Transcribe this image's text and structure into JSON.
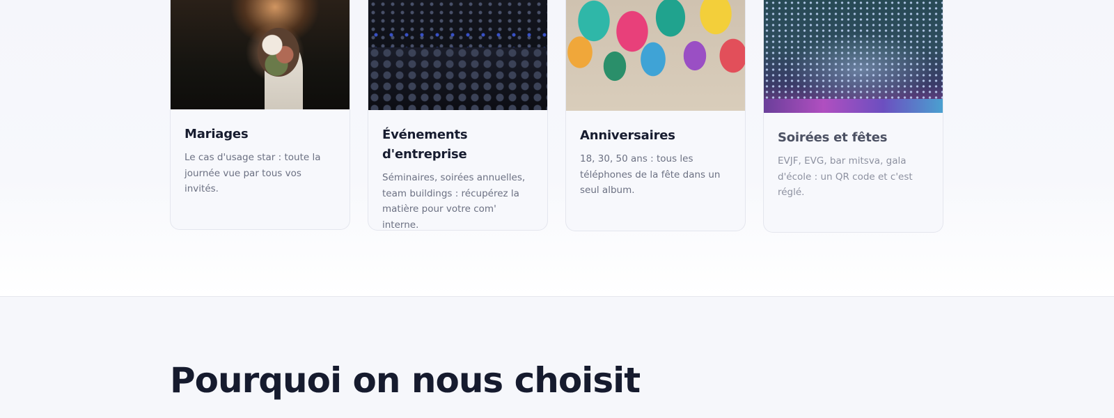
{
  "cards": [
    {
      "title": "Mariages",
      "description": "Le cas d'usage star : toute la journée vue par tous vos invités."
    },
    {
      "title": "Événements d'entreprise",
      "description": "Séminaires, soirées annuelles, team buildings : récupérez la matière pour votre com' interne."
    },
    {
      "title": "Anniversaires",
      "description": "18, 30, 50 ans : tous les téléphones de la fête dans un seul album."
    },
    {
      "title": "Soirées et fêtes",
      "description": "EVJF, EVG, bar mitsva, gala d'école : un QR code et c'est réglé."
    }
  ],
  "why_section": {
    "title": "Pourquoi on nous choisit"
  }
}
